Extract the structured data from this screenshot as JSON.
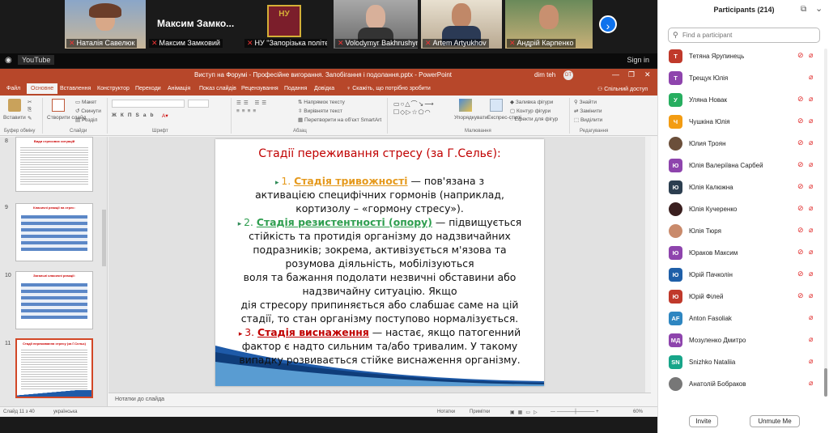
{
  "gallery": {
    "tiles": [
      {
        "name": "Наталія Савелюк"
      },
      {
        "name": "Максим Замковий",
        "big_label": "Максим Замко..."
      },
      {
        "name": "НУ \"Запорізька політе..."
      },
      {
        "name": "Volodymyr Bakhrushyn"
      },
      {
        "name": "Artem Artyukhov"
      },
      {
        "name": "Андрій Карпенко"
      }
    ],
    "logo_text": "НУ",
    "next_icon": "chevron-right-icon"
  },
  "youtube_bar": {
    "label": "YouTube",
    "sign_in": "Sign in"
  },
  "powerpoint": {
    "title": "Виступ на Форумі - Професійне вигорання. Запобігання і подолання.pptx  -  PowerPoint",
    "user": "dim teh",
    "avatar": "DT",
    "window_controls": [
      "—",
      "❐",
      "✕"
    ],
    "menu": [
      {
        "label": "Файл"
      },
      {
        "label": "Основне",
        "active": true
      },
      {
        "label": "Вставлення"
      },
      {
        "label": "Конструктор"
      },
      {
        "label": "Переходи"
      },
      {
        "label": "Анімація"
      },
      {
        "label": "Показ слайдів"
      },
      {
        "label": "Рецензування"
      },
      {
        "label": "Подання"
      },
      {
        "label": "Довідка"
      },
      {
        "label": "Скажіть, що потрібно зробити"
      }
    ],
    "share": "Спільний доступ",
    "ribbon": {
      "paste": "Вставити",
      "create_slide": "Створити слайд",
      "layout": "Макет",
      "reset": "Скинути",
      "section": "Розділ",
      "direction": "Напрямок тексту",
      "align": "Вирівняти текст",
      "smartart": "Перетворити на об'єкт SmartArt",
      "arrange": "Упорядкувати",
      "quick_styles": "Експрес-стилі",
      "fill": "Заливка фігури",
      "outline": "Контур фігури",
      "effects": "Ефекти для фігур",
      "find": "Знайти",
      "replace": "Замінити",
      "select": "Виділити",
      "groups": [
        "Буфер обміну",
        "Слайди",
        "Шрифт",
        "Абзац",
        "Малювання",
        "Редагування"
      ]
    },
    "thumbnails": [
      {
        "num": "8",
        "title": "Види стресових ситуацій"
      },
      {
        "num": "9",
        "title": "Класичні реакції на стрес:"
      },
      {
        "num": "10",
        "title": "Загальні класичні реакції:"
      },
      {
        "num": "11",
        "title": "Стадії переживання стресу (за Г.Сельє)",
        "selected": true
      }
    ],
    "slide": {
      "title": "Стадії переживання стресу (за Г.Сельє):",
      "s1_num": "1.",
      "s1_name": "Стадія тривожності",
      "s1_rest": " — пов'язана з",
      "l2": "активацією специфічних гормонів (наприклад,",
      "l3": "кортизолу – «гормону стресу»).",
      "s2_num": "2.",
      "s2_name": "Стадія резистентності (опору)",
      "s2_rest": " — підвищується",
      "l5": "стійкість та протидія організму до надзвичайних",
      "l6": "подразників; зокрема, активізується м'язова та",
      "l7": "розумова діяльність, мобілізуються",
      "l8": "воля та бажання подолати незвичні обставини або",
      "l9": "надзвичайну ситуацію. Якщо",
      "l10": "дія стресору припиняється або слабшає саме на цій",
      "l11": "стадії, то стан організму поступово нормалізується.",
      "s3_num": "3.",
      "s3_name": "Стадія виснаження",
      "s3_rest": " — настає, якщо патогенний",
      "l13": "фактор є надто сильним та/або тривалим. У такому",
      "l14": "випадку розвивається стійке виснаження організму."
    },
    "notes": "Нотатки до слайда",
    "status": {
      "slide": "Слайд 11 з 40",
      "lang": "українська",
      "notes": "Нотатки",
      "comments": "Примітки",
      "zoom": "60%"
    }
  },
  "participants": {
    "title": "Participants (214)",
    "search_placeholder": "Find a participant",
    "invite": "Invite",
    "mute_me": "Unmute Me",
    "list": [
      {
        "initial": "Т",
        "name": "Тетяна Ярупинець",
        "color": "#c0392b",
        "cam_off": true
      },
      {
        "initial": "Т",
        "name": "Трещук Юлія",
        "color": "#8e44ad",
        "cam_off": false
      },
      {
        "initial": "У",
        "name": "Уляна Новак",
        "color": "#27ae60",
        "cam_off": true
      },
      {
        "initial": "Ч",
        "name": "Чушкіна Юлія",
        "color": "#f39c12",
        "cam_off": true
      },
      {
        "initial": "",
        "name": "Юлия Троян",
        "color": "#6b4f3a",
        "cam_off": true
      },
      {
        "initial": "Ю",
        "name": "Юлія Валеріївна Сарбей",
        "color": "#8e44ad",
        "cam_off": true
      },
      {
        "initial": "Ю",
        "name": "Юлія Калюжна",
        "color": "#2c3e50",
        "cam_off": true
      },
      {
        "initial": "",
        "name": "Юлія Кучеренко",
        "color": "#3a1f1f",
        "cam_off": true
      },
      {
        "initial": "",
        "name": "Юлія Тюря",
        "color": "#c98a6b",
        "cam_off": true
      },
      {
        "initial": "Ю",
        "name": "Юраков Максим",
        "color": "#8e44ad",
        "cam_off": true
      },
      {
        "initial": "Ю",
        "name": "Юрій Пачколін",
        "color": "#1f5fa8",
        "cam_off": true
      },
      {
        "initial": "Ю",
        "name": "Юрій Філей",
        "color": "#c0392b",
        "cam_off": true
      },
      {
        "initial": "AF",
        "name": "Anton Fasoliak",
        "color": "#2e86c1",
        "cam_off": false
      },
      {
        "initial": "МД",
        "name": "Мозуленко Дмитро",
        "color": "#8e44ad",
        "cam_off": false
      },
      {
        "initial": "SN",
        "name": "Snizhko Nataliia",
        "color": "#17a589",
        "cam_off": false
      },
      {
        "initial": "",
        "name": "Анатолій Бобраков",
        "color": "#777777",
        "cam_off": false
      }
    ]
  }
}
